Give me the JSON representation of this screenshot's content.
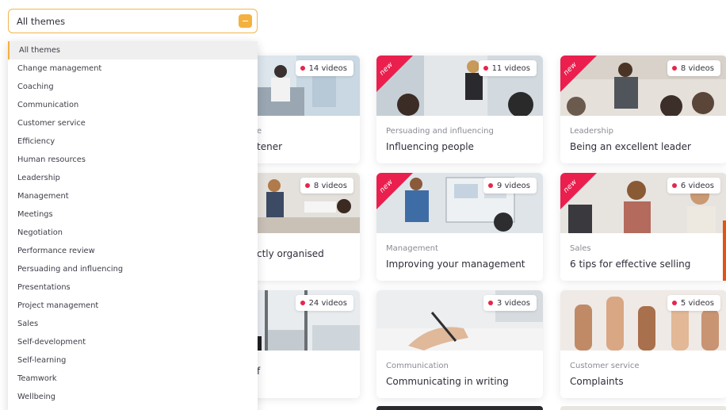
{
  "theme_filter": {
    "selected": "All themes",
    "options": [
      "All themes",
      "Change management",
      "Coaching",
      "Communication",
      "Customer service",
      "Efficiency",
      "Human resources",
      "Leadership",
      "Management",
      "Meetings",
      "Negotiation",
      "Performance review",
      "Persuading and influencing",
      "Presentations",
      "Project management",
      "Sales",
      "Self-development",
      "Self-learning",
      "Teamwork",
      "Wellbeing"
    ]
  },
  "ribbon_label": "new",
  "accent_colors": {
    "dropdown_border": "#f2b64f",
    "new_ribbon": "#ea1f4e",
    "video_dot": "#e5264a"
  },
  "courses": [
    {
      "theme": "",
      "title_fragment": "tener",
      "videos": "14 videos",
      "is_new": false,
      "image": "office-team-at-desks"
    },
    {
      "theme": "Persuading and influencing",
      "title": "Influencing people",
      "videos": "11 videos",
      "is_new": true,
      "image": "woman-presenting"
    },
    {
      "theme": "Leadership",
      "title": "Being an excellent leader",
      "videos": "8 videos",
      "is_new": true,
      "image": "man-presenting-to-audience"
    },
    {
      "theme": "",
      "title_fragment": "ctly organised",
      "videos": "8 videos",
      "is_new": false,
      "image": "business-meeting-papers"
    },
    {
      "theme": "Management",
      "title": "Improving your management",
      "videos": "9 videos",
      "is_new": true,
      "image": "man-at-whiteboard"
    },
    {
      "theme": "Sales",
      "title": "6 tips for effective selling",
      "videos": "6 videos",
      "is_new": true,
      "image": "smiling-woman-in-office"
    },
    {
      "theme": "",
      "title_fragment": "f",
      "videos": "24 videos",
      "is_new": false,
      "image": "city-window"
    },
    {
      "theme": "Communication",
      "title": "Communicating in writing",
      "videos": "3 videos",
      "is_new": false,
      "image": "hand-writing"
    },
    {
      "theme": "Customer service",
      "title": "Complaints",
      "videos": "5 videos",
      "is_new": false,
      "image": "raised-hands"
    }
  ]
}
